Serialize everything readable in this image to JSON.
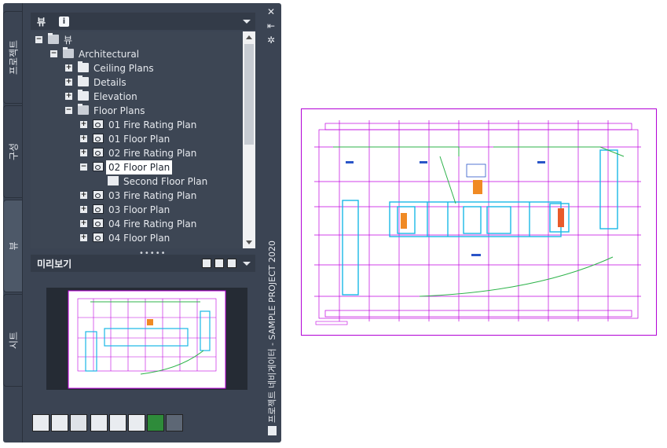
{
  "side_tabs": [
    {
      "label": "프로젝트"
    },
    {
      "label": "구성"
    },
    {
      "label": "뷰"
    },
    {
      "label": "시트"
    }
  ],
  "tree_header": {
    "title": "뷰",
    "info": "i"
  },
  "tree": {
    "root": "뷰",
    "architectural": "Architectural",
    "ceiling_plans": "Ceiling Plans",
    "details": "Details",
    "elevation": "Elevation",
    "floor_plans": "Floor Plans",
    "items": [
      "01 Fire Rating Plan",
      "01 Floor Plan",
      "02 Fire Rating Plan",
      "02 Floor Plan",
      "Second Floor Plan",
      "03 Fire Rating Plan",
      "03 Floor Plan",
      "04 Fire Rating Plan",
      "04 Floor Plan"
    ]
  },
  "splitter": "•••••",
  "preview_header": {
    "title": "미리보기"
  },
  "palette_title": "프로젝트 네비게이터 - SAMPLE PROJECT 2020",
  "side_icons": {
    "close": "✕",
    "autohide": "⇤",
    "properties": "✲"
  },
  "colors": {
    "panel": "#3b4453",
    "magenta": "#c000e0",
    "cyan": "#19b8e6",
    "green": "#2db34a"
  }
}
